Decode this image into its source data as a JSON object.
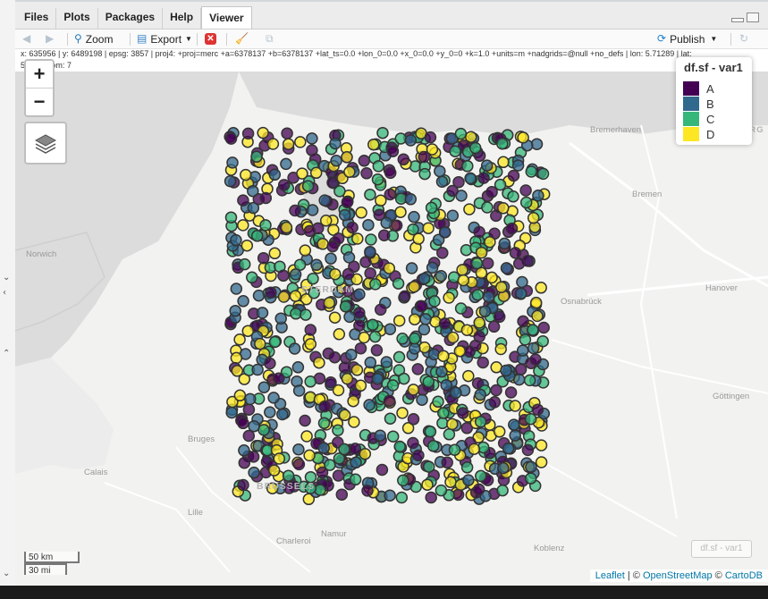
{
  "tabs": [
    "Files",
    "Plots",
    "Packages",
    "Help",
    "Viewer"
  ],
  "active_tab": "Viewer",
  "toolbar": {
    "zoom_label": "Zoom",
    "export_label": "Export",
    "publish_label": "Publish"
  },
  "info_text": "x: 635956 | y: 6489198 | epsg: 3857 | proj4: +proj=merc +a=6378137 +b=6378137 +lat_ts=0.0 +lon_0=0.0 +x_0=0.0 +y_0=0 +k=1.0 +units=m +nadgrids=@null +no_defs | lon: 5.71289 | lat:",
  "info_text_2": "51.0 | zoom: 7",
  "zoom_controls": {
    "in": "+",
    "out": "−"
  },
  "legend": {
    "title": "df.sf - var1",
    "items": [
      {
        "label": "A",
        "color": "#440154"
      },
      {
        "label": "B",
        "color": "#31688e"
      },
      {
        "label": "C",
        "color": "#35b779"
      },
      {
        "label": "D",
        "color": "#fde725"
      }
    ]
  },
  "mini_legend": "df.sf - var1",
  "scale": {
    "km": "50 km",
    "mi": "30 mi"
  },
  "attribution": {
    "leaflet": "Leaflet",
    "sep": " | © ",
    "osm": "OpenStreetMap",
    "sep2": " © ",
    "carto": "CartoDB"
  },
  "cities": [
    "Bremerhaven",
    "HAMBURG",
    "Bremen",
    "Norwich",
    "Hanover",
    "Osnabrück",
    "Göttingen",
    "Bruges",
    "Calais",
    "Lille",
    "Namur",
    "Charleroi",
    "Koblenz",
    "BRUSSELS",
    "STERDAM"
  ],
  "points": {
    "count": 1000,
    "categories": [
      "A",
      "B",
      "C",
      "D"
    ],
    "extent_note": "random points roughly covering Netherlands/Belgium area"
  }
}
